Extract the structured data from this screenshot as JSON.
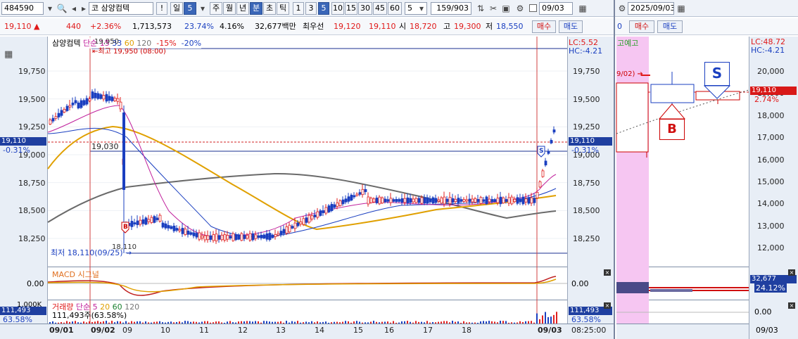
{
  "toolbar": {
    "code": "484590",
    "market_tag": "코",
    "stock_name": "삼양컴텍",
    "alert": "!",
    "period_label": "일",
    "period_num": "5",
    "periods": [
      "주",
      "월",
      "년",
      "분",
      "초",
      "틱"
    ],
    "active_period": "분",
    "intervals": [
      "1",
      "3",
      "5",
      "10",
      "15",
      "30",
      "45",
      "60"
    ],
    "active_interval": "5",
    "count_value": "5",
    "page": "159",
    "page_total": "/903",
    "date_value": "09/03",
    "right_date": "2025/09/03"
  },
  "quote": {
    "price": "19,110",
    "change": "440",
    "change_pct": "+2.36%",
    "volume": "1,713,573",
    "turnover_pct": "23.74%",
    "ratio_pct": "4.16%",
    "amount": "32,677백만",
    "best_label": "최우선",
    "best_ask": "19,120",
    "best_bid": "19,110",
    "open_label": "시",
    "open": "18,720",
    "high_label": "고",
    "high": "19,300",
    "low_label": "저",
    "low": "18,550",
    "buy_label": "매수",
    "sell_label": "매도",
    "right_zero": "0"
  },
  "main_chart": {
    "legend_name": "삼양컴텍",
    "legend_ma": "단순",
    "ma_periods": [
      "15",
      "33",
      "60",
      "120"
    ],
    "ma_colors": [
      "#c0209c",
      "#1a3fc0",
      "#e0a000",
      "#555555"
    ],
    "legend_pct": [
      "-15%",
      "-20%"
    ],
    "lc_label": "LC:5.52",
    "hc_label": "HC:-4.21",
    "high_marker": "최고 19,950 (08:00)",
    "high_val": "19,950",
    "low_marker": "최저 18,110(09/25)",
    "low_small": "18,110",
    "ref_line": "19,030",
    "price_tag": "19,110",
    "price_pct": "-0.31%",
    "y_ticks": [
      "19,750",
      "19,500",
      "19,250",
      "19,000",
      "18,750",
      "18,500",
      "18,250"
    ],
    "x_ticks": [
      "09/01",
      "09/02",
      "09",
      "10",
      "11",
      "12",
      "13",
      "14",
      "15",
      "16",
      "17",
      "18",
      "09/03",
      "08:25:00"
    ],
    "buy_marker": "B",
    "sell_marker": "S"
  },
  "macd": {
    "title": "MACD",
    "signal": "시그널",
    "zero": "0.00"
  },
  "volume_pane": {
    "title": "거래량",
    "ma": "단순",
    "periods": [
      "5",
      "20",
      "60",
      "120"
    ],
    "value_line": "111,493주(63.58%)",
    "tag": "111,493",
    "pct": "63.58%",
    "scale": "1,000K"
  },
  "right_chart": {
    "tab": "고예고",
    "lc_label": "LC:48.72",
    "hc_label": "HC:-4.21",
    "marker_date": "9/02)",
    "y_ticks": [
      "20,000",
      "19,000",
      "18,000",
      "17,000",
      "16,000",
      "15,000",
      "14,000",
      "13,000",
      "12,000"
    ],
    "price_tag": "19,110",
    "price_pct": "2.74%",
    "buy_marker": "B",
    "sell_marker": "S",
    "macd_tag": "32,677",
    "macd_pct": "24.12%",
    "zero": "0.00",
    "x_tick": "09/03"
  }
}
